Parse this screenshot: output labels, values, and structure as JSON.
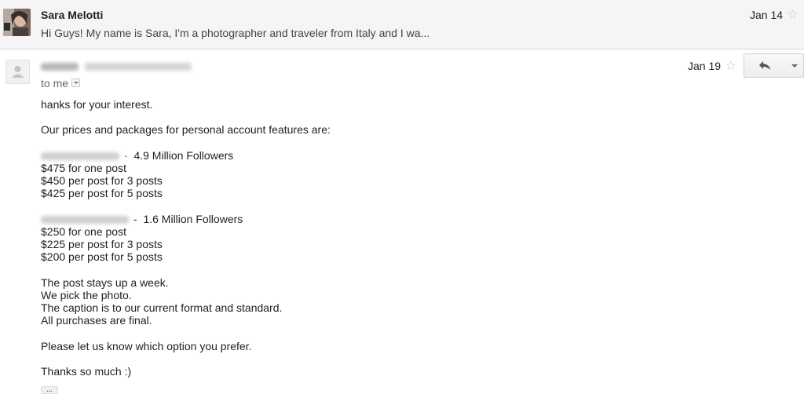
{
  "collapsed_message": {
    "sender": "Sara Melotti",
    "snippet": "Hi Guys! My name is Sara, I'm a photographer and traveler from Italy and I wa...",
    "date": "Jan 14",
    "star_icon": "star-outline-icon"
  },
  "expanded_message": {
    "to": "to me",
    "date": "Jan 19",
    "star_icon": "star-outline-icon",
    "reply_icon": "reply-arrow-icon",
    "more_icon": "chevron-down-icon",
    "body": {
      "greeting": "hanks for your interest.",
      "intro": "Our prices and packages for personal account features are:",
      "package1": {
        "followers": "·  4.9 Million Followers",
        "prices": [
          "$475 for one post",
          "$450 per post for 3 posts",
          "$425 per post for 5 posts"
        ]
      },
      "package2": {
        "followers": "-  1.6 Million Followers",
        "prices": [
          "$250 for one post",
          "$225 per post for 3 posts",
          "$200 per post for 5 posts"
        ]
      },
      "terms": [
        "The post stays up a week.",
        "We pick the photo.",
        "The caption is to our current format and standard.",
        "All purchases are final."
      ],
      "request": "Please let us know which option you prefer.",
      "signoff": "Thanks so much :)",
      "ellipsis": "..."
    }
  }
}
